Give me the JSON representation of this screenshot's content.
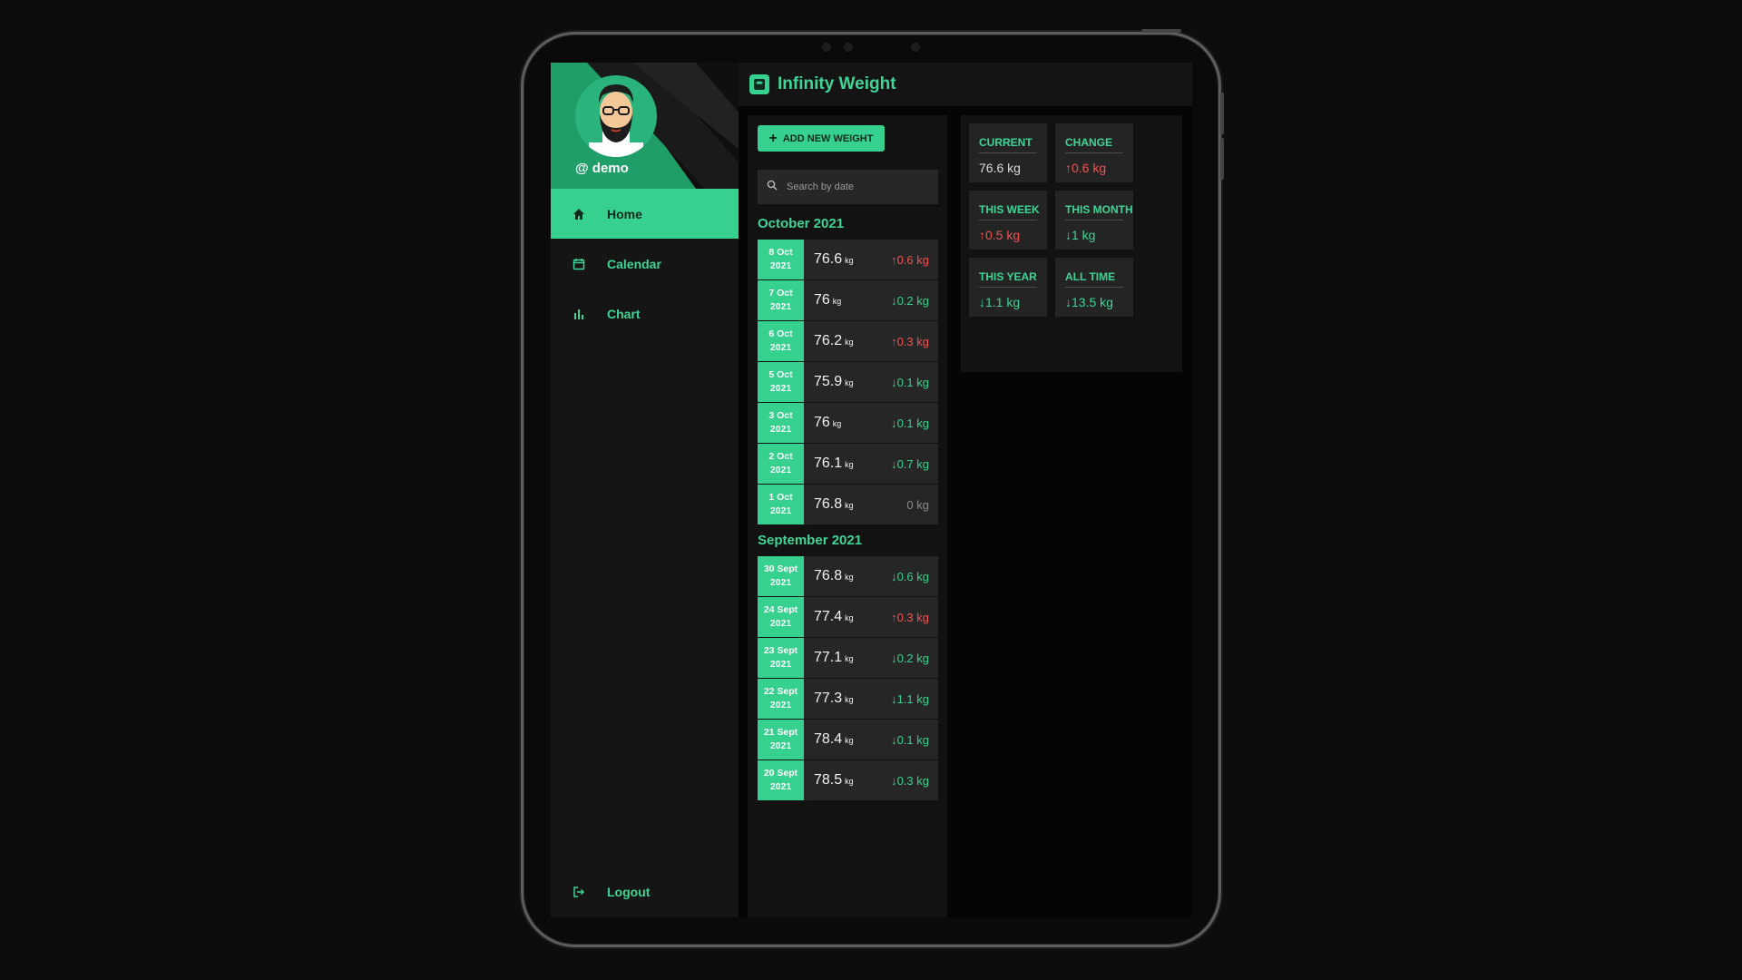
{
  "app": {
    "title": "Infinity Weight"
  },
  "profile": {
    "username": "@ demo"
  },
  "nav": [
    {
      "label": "Home",
      "icon": "home-icon",
      "active": true
    },
    {
      "label": "Calendar",
      "icon": "calendar-icon",
      "active": false
    },
    {
      "label": "Chart",
      "icon": "bar-chart-icon",
      "active": false
    }
  ],
  "logout": {
    "label": "Logout",
    "icon": "logout-icon"
  },
  "actions": {
    "add_label": "ADD NEW WEIGHT"
  },
  "search": {
    "placeholder": "Search by date"
  },
  "months": [
    {
      "label": "October 2021",
      "entries": [
        {
          "day": "8 Oct",
          "year": "2021",
          "weight": "76.6",
          "unit": "kg",
          "change": "0.6 kg",
          "dir": "up"
        },
        {
          "day": "7 Oct",
          "year": "2021",
          "weight": "76",
          "unit": "kg",
          "change": "0.2 kg",
          "dir": "down"
        },
        {
          "day": "6 Oct",
          "year": "2021",
          "weight": "76.2",
          "unit": "kg",
          "change": "0.3 kg",
          "dir": "up"
        },
        {
          "day": "5 Oct",
          "year": "2021",
          "weight": "75.9",
          "unit": "kg",
          "change": "0.1 kg",
          "dir": "down"
        },
        {
          "day": "3 Oct",
          "year": "2021",
          "weight": "76",
          "unit": "kg",
          "change": "0.1 kg",
          "dir": "down"
        },
        {
          "day": "2 Oct",
          "year": "2021",
          "weight": "76.1",
          "unit": "kg",
          "change": "0.7 kg",
          "dir": "down"
        },
        {
          "day": "1 Oct",
          "year": "2021",
          "weight": "76.8",
          "unit": "kg",
          "change": "0 kg",
          "dir": "none"
        }
      ]
    },
    {
      "label": "September 2021",
      "entries": [
        {
          "day": "30 Sept",
          "year": "2021",
          "weight": "76.8",
          "unit": "kg",
          "change": "0.6 kg",
          "dir": "down"
        },
        {
          "day": "24 Sept",
          "year": "2021",
          "weight": "77.4",
          "unit": "kg",
          "change": "0.3 kg",
          "dir": "up"
        },
        {
          "day": "23 Sept",
          "year": "2021",
          "weight": "77.1",
          "unit": "kg",
          "change": "0.2 kg",
          "dir": "down"
        },
        {
          "day": "22 Sept",
          "year": "2021",
          "weight": "77.3",
          "unit": "kg",
          "change": "1.1 kg",
          "dir": "down"
        },
        {
          "day": "21 Sept",
          "year": "2021",
          "weight": "78.4",
          "unit": "kg",
          "change": "0.1 kg",
          "dir": "down"
        },
        {
          "day": "20 Sept",
          "year": "2021",
          "weight": "78.5",
          "unit": "kg",
          "change": "0.3 kg",
          "dir": "down"
        }
      ]
    }
  ],
  "stats": [
    {
      "label": "CURRENT",
      "value": "76.6 kg",
      "dir": "none"
    },
    {
      "label": "CHANGE",
      "value": "0.6 kg",
      "dir": "up"
    },
    {
      "label": "THIS WEEK",
      "value": "0.5 kg",
      "dir": "up"
    },
    {
      "label": "THIS MONTH",
      "value": "1 kg",
      "dir": "down"
    },
    {
      "label": "THIS YEAR",
      "value": "1.1 kg",
      "dir": "down"
    },
    {
      "label": "ALL TIME",
      "value": "13.5 kg",
      "dir": "down"
    }
  ],
  "colors": {
    "accent": "#37d18f",
    "accent_text": "#3ed596",
    "increase": "#ef5353",
    "background": "#050505",
    "panel": "#121212",
    "card": "#262626"
  }
}
